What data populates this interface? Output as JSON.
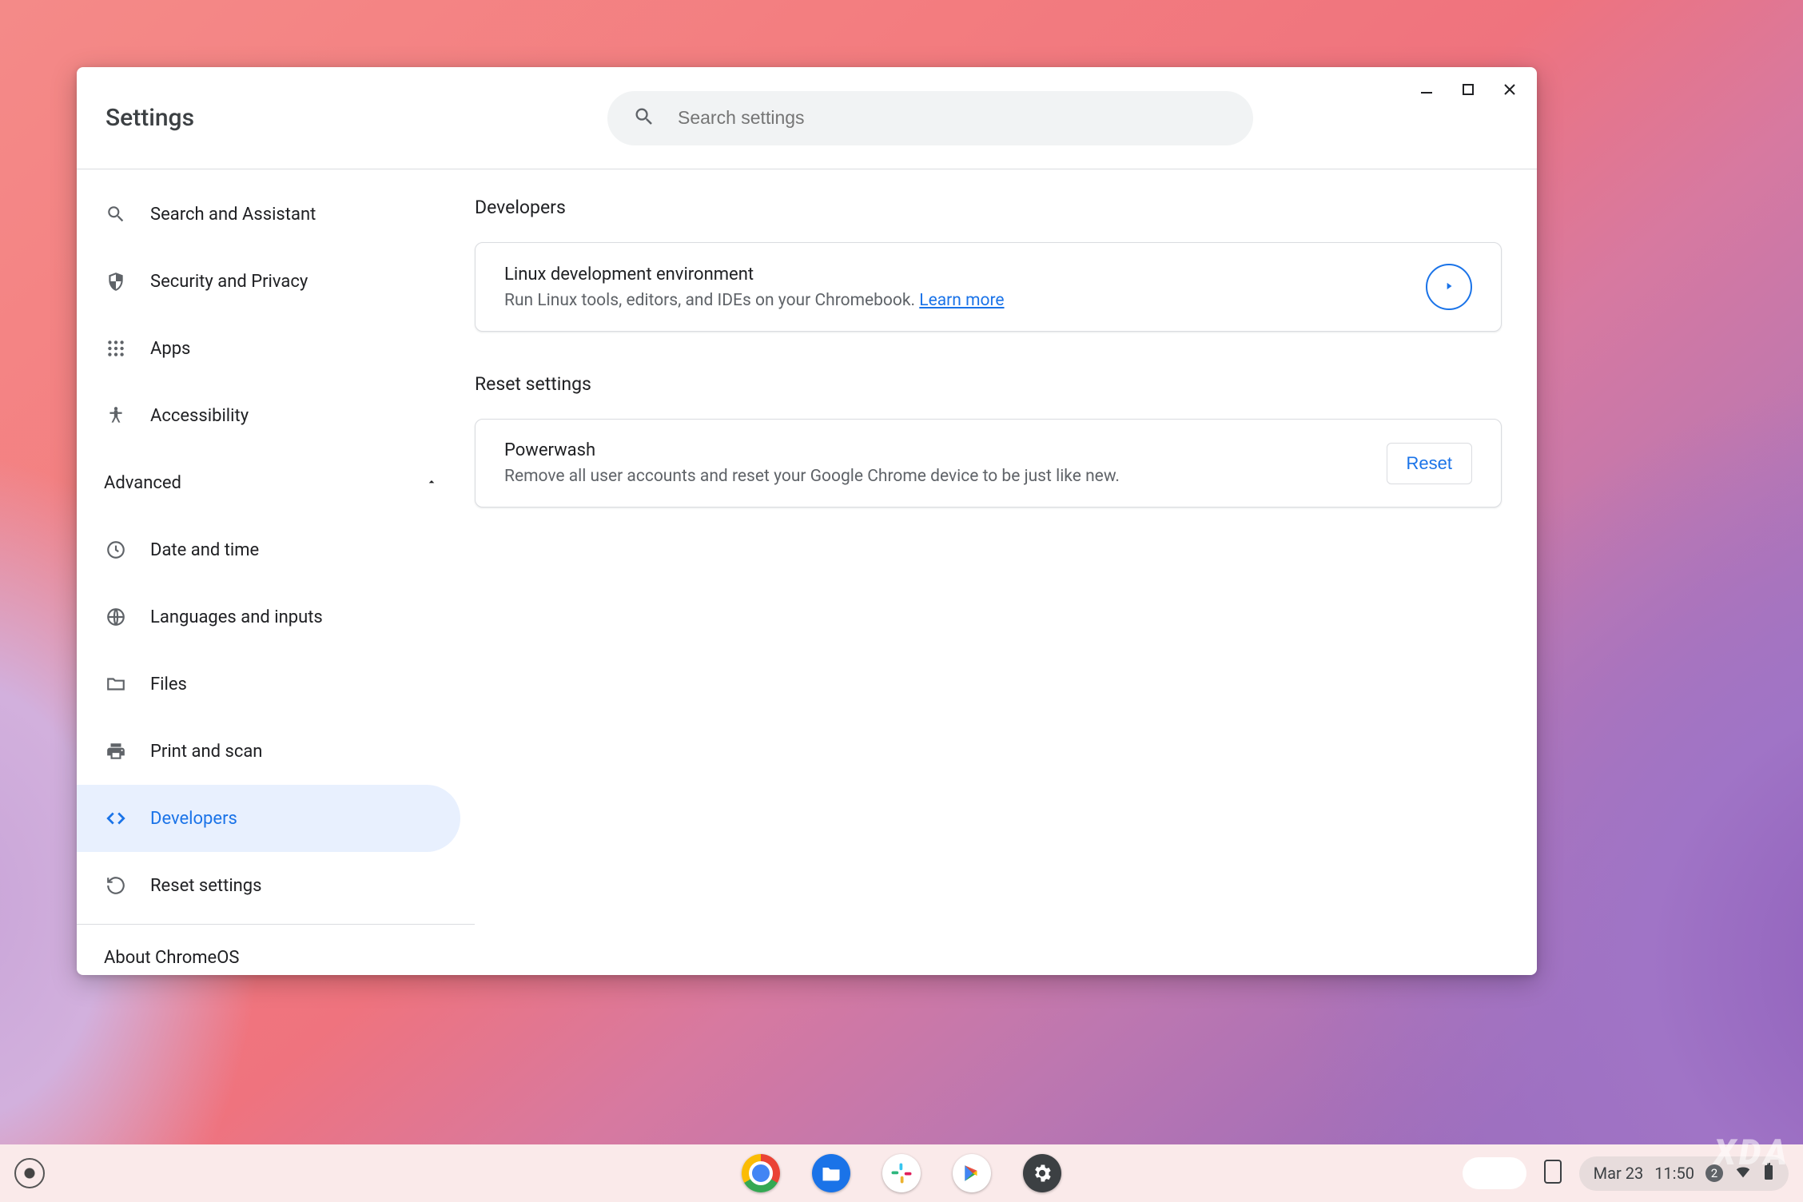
{
  "window": {
    "title": "Settings",
    "search_placeholder": "Search settings"
  },
  "sidebar": {
    "items": [
      {
        "id": "search-assistant",
        "label": "Search and Assistant"
      },
      {
        "id": "security-privacy",
        "label": "Security and Privacy"
      },
      {
        "id": "apps",
        "label": "Apps"
      },
      {
        "id": "accessibility",
        "label": "Accessibility"
      }
    ],
    "advanced_label": "Advanced",
    "advanced_expanded": true,
    "advanced_items": [
      {
        "id": "date-time",
        "label": "Date and time"
      },
      {
        "id": "languages",
        "label": "Languages and inputs"
      },
      {
        "id": "files",
        "label": "Files"
      },
      {
        "id": "print",
        "label": "Print and scan"
      },
      {
        "id": "developers",
        "label": "Developers",
        "active": true
      },
      {
        "id": "reset",
        "label": "Reset settings"
      }
    ],
    "about_label": "About ChromeOS"
  },
  "main": {
    "developers": {
      "heading": "Developers",
      "linux": {
        "title": "Linux development environment",
        "subtitle_prefix": "Run Linux tools, editors, and IDEs on your Chromebook. ",
        "learn_more": "Learn more"
      }
    },
    "reset": {
      "heading": "Reset settings",
      "powerwash": {
        "title": "Powerwash",
        "subtitle": "Remove all user accounts and reset your Google Chrome device to be just like new.",
        "button": "Reset"
      }
    }
  },
  "shelf": {
    "apps": [
      "Chrome",
      "Files",
      "Slack",
      "Play Store",
      "Settings"
    ],
    "date": "Mar 23",
    "time": "11:50",
    "notification_count": "2"
  },
  "watermark": "XDA"
}
